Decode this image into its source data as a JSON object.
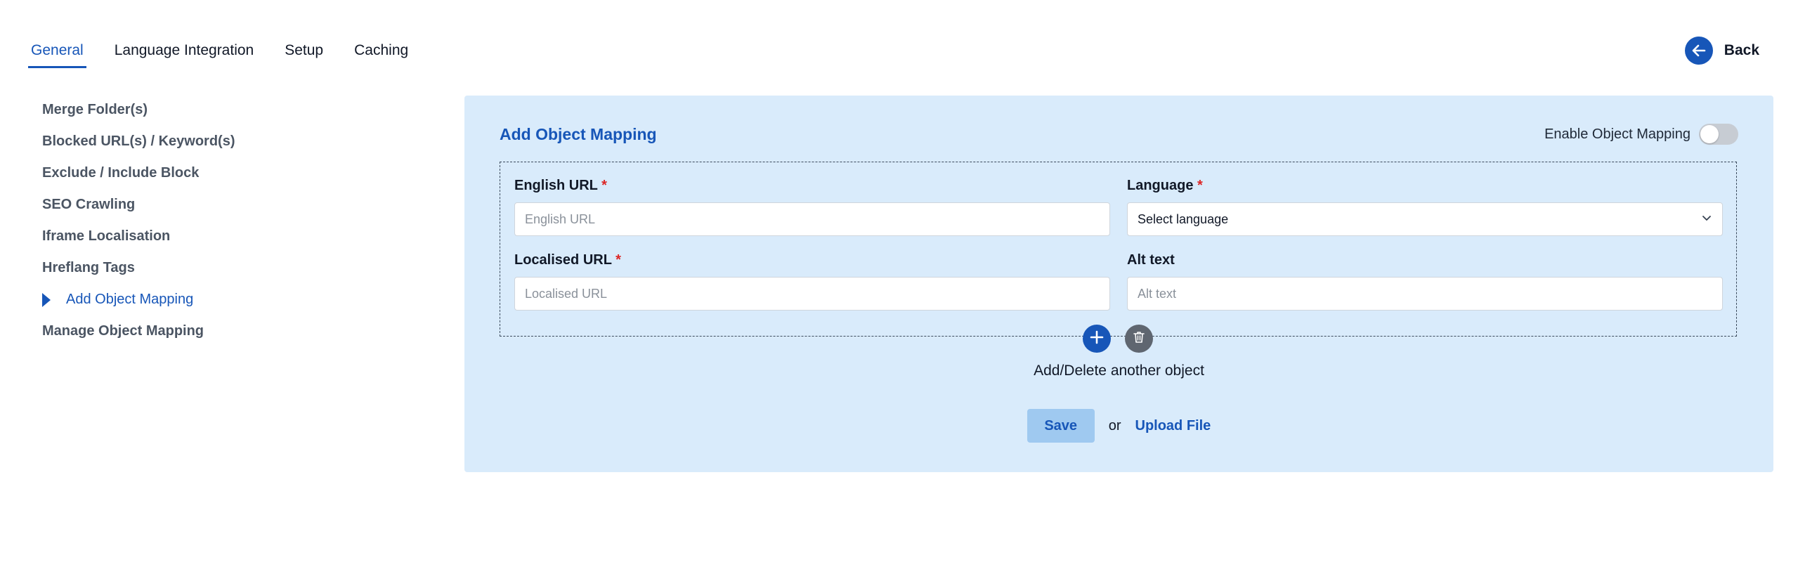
{
  "tabs": [
    {
      "label": "General",
      "active": true
    },
    {
      "label": "Language Integration",
      "active": false
    },
    {
      "label": "Setup",
      "active": false
    },
    {
      "label": "Caching",
      "active": false
    }
  ],
  "back": {
    "label": "Back",
    "icon": "arrow-left-icon"
  },
  "sidebar": {
    "items": [
      {
        "label": "Merge Folder(s)"
      },
      {
        "label": "Blocked URL(s) / Keyword(s)"
      },
      {
        "label": "Exclude / Include Block"
      },
      {
        "label": "SEO Crawling"
      },
      {
        "label": "Iframe Localisation"
      },
      {
        "label": "Hreflang Tags"
      },
      {
        "label": "Add Object Mapping",
        "active": true
      },
      {
        "label": "Manage Object Mapping"
      }
    ]
  },
  "panel": {
    "title": "Add Object Mapping",
    "enable_label": "Enable Object Mapping",
    "enable_on": false,
    "fields": {
      "english_url": {
        "label": "English URL",
        "required_mark": "*",
        "placeholder": "English URL",
        "value": ""
      },
      "language": {
        "label": "Language",
        "required_mark": "*",
        "selected": "Select language"
      },
      "localised_url": {
        "label": "Localised URL",
        "required_mark": "*",
        "placeholder": "Localised URL",
        "value": ""
      },
      "alt_text": {
        "label": "Alt text",
        "placeholder": "Alt text",
        "value": ""
      }
    },
    "add_delete_text": "Add/Delete another object",
    "save_label": "Save",
    "or_text": "or",
    "upload_label": "Upload File"
  },
  "colors": {
    "accent": "#1756b8",
    "panel_bg": "#d9ebfb",
    "save_bg": "#9fc9f0",
    "required": "#dc2626"
  }
}
